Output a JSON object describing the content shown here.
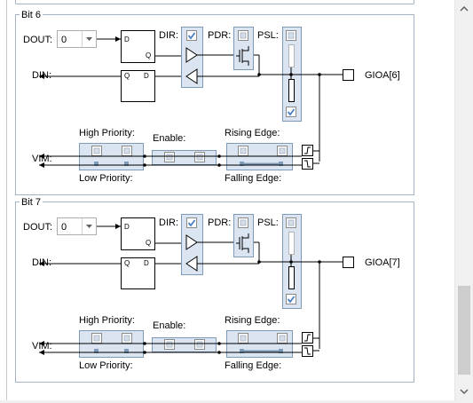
{
  "groups": [
    {
      "title": "Bit 6",
      "dout_label": "DOUT:",
      "dout_value": "0",
      "din_label": "DIN:",
      "vim_label": "VIM:",
      "dir_label": "DIR:",
      "pdr_label": "PDR:",
      "psl_label": "PSL:",
      "high_priority_label": "High Priority:",
      "low_priority_label": "Low Priority:",
      "enable_label": "Enable:",
      "rising_edge_label": "Rising Edge:",
      "falling_edge_label": "Falling Edge:",
      "pin_label": "GIOA[6]",
      "ff_d": "D",
      "ff_q": "Q",
      "checks": {
        "dir": true,
        "pdr": false,
        "psl_top": false,
        "psl_bottom": true
      }
    },
    {
      "title": "Bit 7",
      "dout_label": "DOUT:",
      "dout_value": "0",
      "din_label": "DIN:",
      "vim_label": "VIM:",
      "dir_label": "DIR:",
      "pdr_label": "PDR:",
      "psl_label": "PSL:",
      "high_priority_label": "High Priority:",
      "low_priority_label": "Low Priority:",
      "enable_label": "Enable:",
      "rising_edge_label": "Rising Edge:",
      "falling_edge_label": "Falling Edge:",
      "pin_label": "GIOA[7]",
      "ff_d": "D",
      "ff_q": "Q",
      "checks": {
        "dir": true,
        "pdr": false,
        "psl_top": false,
        "psl_bottom": true
      }
    }
  ],
  "scrollbar": {
    "up_icon": "chevron-up-icon",
    "down_icon": "chevron-down-icon"
  },
  "colors": {
    "group_border": "#a3b3c6",
    "box_fill": "#dae5f1",
    "box_border": "#7d9ab8",
    "check_blue": "#4a7fc0",
    "dropdown_border": "#abadb3"
  }
}
